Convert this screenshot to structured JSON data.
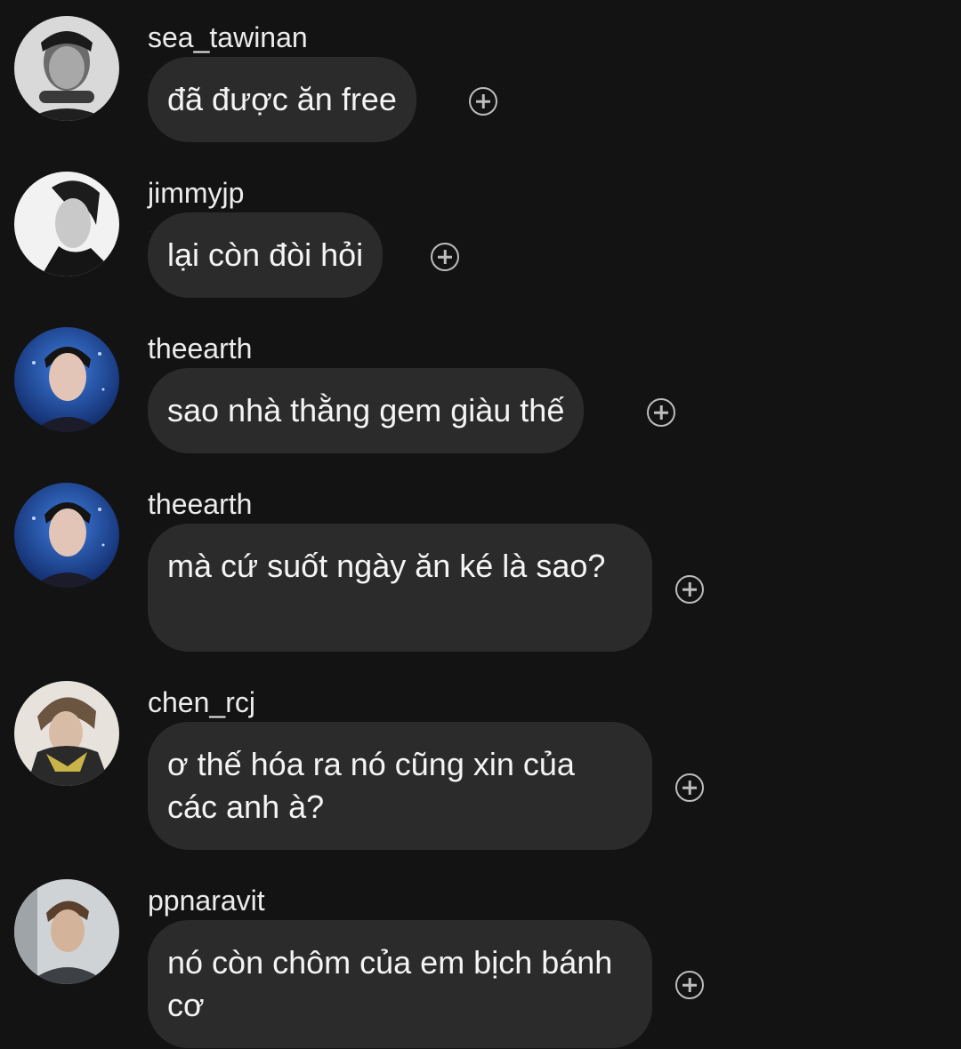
{
  "messages": [
    {
      "username": "sea_tawinan",
      "text": "đã được ăn free",
      "avatar": "portrait-bw-hands-icon"
    },
    {
      "username": "jimmyjp",
      "text": "lại còn đòi hỏi",
      "avatar": "portrait-profile-icon"
    },
    {
      "username": "theearth",
      "text": "sao nhà thằng gem giàu thế",
      "avatar": "portrait-blue-stage-icon"
    },
    {
      "username": "theearth",
      "text": "mà cứ suốt ngày ăn ké là sao?",
      "avatar": "portrait-blue-stage-icon"
    },
    {
      "username": "chen_rcj",
      "text": "ơ thế hóa ra nó cũng xin của các anh à?",
      "avatar": "portrait-scarf-icon"
    },
    {
      "username": "ppnaravit",
      "text": "nó còn chôm của em bịch bánh cơ",
      "avatar": "portrait-casual-icon"
    }
  ],
  "react_button_icon": "add-reaction-icon",
  "colors": {
    "background": "#131313",
    "bubble": "#2b2b2b",
    "text": "#f4f4f4",
    "icon": "#bdbdbd"
  }
}
